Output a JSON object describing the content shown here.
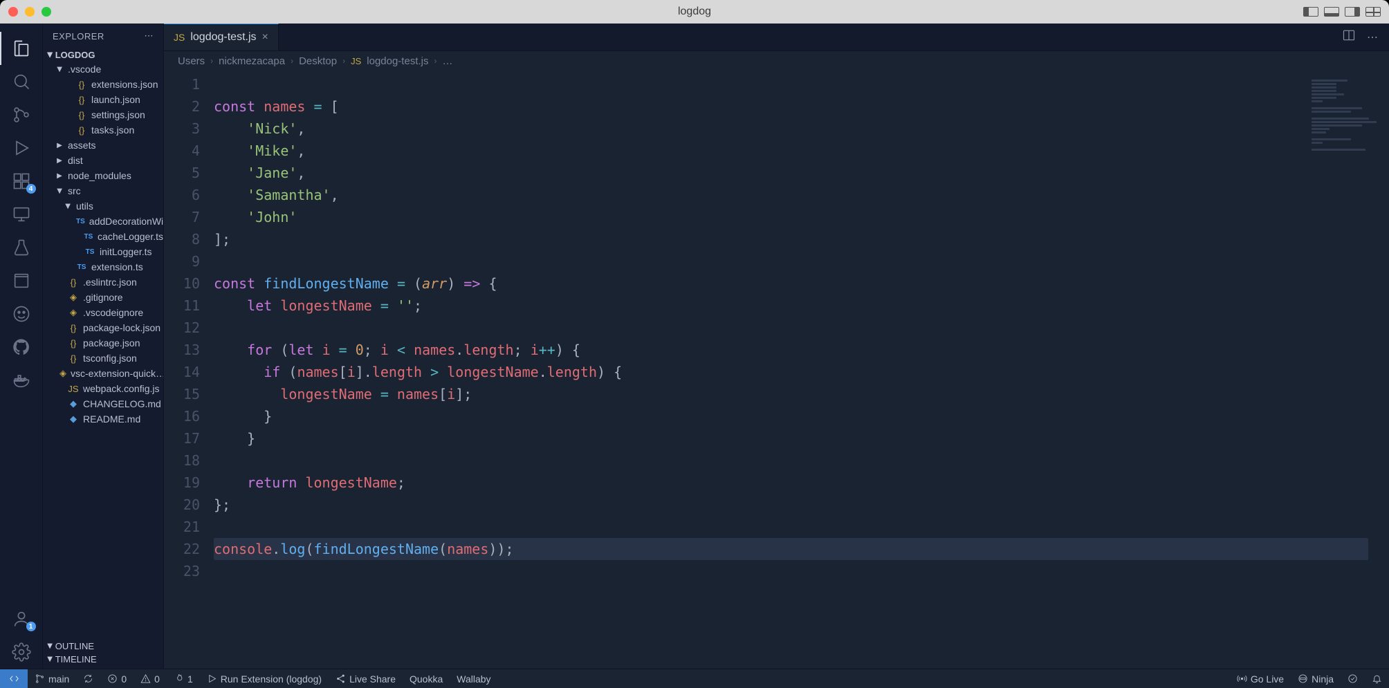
{
  "window": {
    "title": "logdog"
  },
  "titlebar_icons": [
    "split-l",
    "split-b",
    "split-r",
    "grid"
  ],
  "activitybar": {
    "top": [
      {
        "name": "explorer",
        "active": true
      },
      {
        "name": "search"
      },
      {
        "name": "scm"
      },
      {
        "name": "run-debug"
      },
      {
        "name": "extensions",
        "badge": "4"
      },
      {
        "name": "remote-explorer"
      },
      {
        "name": "testing"
      },
      {
        "name": "references"
      },
      {
        "name": "copilot"
      },
      {
        "name": "github"
      },
      {
        "name": "docker"
      }
    ],
    "bottom": [
      {
        "name": "accounts",
        "badge": "1"
      },
      {
        "name": "settings-gear"
      }
    ]
  },
  "sidebar": {
    "title": "EXPLORER",
    "folder": "LOGDOG",
    "tree": [
      {
        "type": "folder",
        "name": ".vscode",
        "expanded": true,
        "depth": 1,
        "children": [
          {
            "type": "file",
            "name": "extensions.json",
            "icon": "json",
            "depth": 2
          },
          {
            "type": "file",
            "name": "launch.json",
            "icon": "json",
            "depth": 2
          },
          {
            "type": "file",
            "name": "settings.json",
            "icon": "json",
            "depth": 2
          },
          {
            "type": "file",
            "name": "tasks.json",
            "icon": "json",
            "depth": 2
          }
        ]
      },
      {
        "type": "folder",
        "name": "assets",
        "expanded": false,
        "depth": 1
      },
      {
        "type": "folder",
        "name": "dist",
        "expanded": false,
        "depth": 1
      },
      {
        "type": "folder",
        "name": "node_modules",
        "expanded": false,
        "depth": 1
      },
      {
        "type": "folder",
        "name": "src",
        "expanded": true,
        "depth": 1,
        "children": [
          {
            "type": "folder",
            "name": "utils",
            "expanded": true,
            "depth": 2,
            "children": [
              {
                "type": "file",
                "name": "addDecorationWi…",
                "icon": "ts",
                "depth": 3
              },
              {
                "type": "file",
                "name": "cacheLogger.ts",
                "icon": "ts",
                "depth": 3
              },
              {
                "type": "file",
                "name": "initLogger.ts",
                "icon": "ts",
                "depth": 3
              }
            ]
          },
          {
            "type": "file",
            "name": "extension.ts",
            "icon": "ts",
            "depth": 2
          }
        ]
      },
      {
        "type": "file",
        "name": ".eslintrc.json",
        "icon": "json",
        "depth": 1
      },
      {
        "type": "file",
        "name": ".gitignore",
        "icon": "file",
        "depth": 1
      },
      {
        "type": "file",
        "name": ".vscodeignore",
        "icon": "file",
        "depth": 1
      },
      {
        "type": "file",
        "name": "package-lock.json",
        "icon": "json",
        "depth": 1
      },
      {
        "type": "file",
        "name": "package.json",
        "icon": "json",
        "depth": 1
      },
      {
        "type": "file",
        "name": "tsconfig.json",
        "icon": "json",
        "depth": 1
      },
      {
        "type": "file",
        "name": "vsc-extension-quick…",
        "icon": "file",
        "depth": 1
      },
      {
        "type": "file",
        "name": "webpack.config.js",
        "icon": "js",
        "depth": 1
      },
      {
        "type": "file",
        "name": "CHANGELOG.md",
        "icon": "md",
        "depth": 1
      },
      {
        "type": "file",
        "name": "README.md",
        "icon": "md",
        "depth": 1
      }
    ],
    "outline": "OUTLINE",
    "timeline": "TIMELINE"
  },
  "tabs": [
    {
      "label": "logdog-test.js",
      "icon": "JS",
      "active": true
    }
  ],
  "breadcrumbs": [
    "Users",
    "nickmezacapa",
    "Desktop",
    "logdog-test.js",
    "…"
  ],
  "code": {
    "lines": [
      {
        "n": 1,
        "tokens": []
      },
      {
        "n": 2,
        "tokens": [
          [
            "kw",
            "const"
          ],
          [
            "pn",
            " "
          ],
          [
            "vr",
            "names"
          ],
          [
            "pn",
            " "
          ],
          [
            "op",
            "="
          ],
          [
            "pn",
            " "
          ],
          [
            "pn",
            "["
          ]
        ]
      },
      {
        "n": 3,
        "tokens": [
          [
            "pn",
            "    "
          ],
          [
            "str",
            "'Nick'"
          ],
          [
            "pn",
            ","
          ]
        ]
      },
      {
        "n": 4,
        "tokens": [
          [
            "pn",
            "    "
          ],
          [
            "str",
            "'Mike'"
          ],
          [
            "pn",
            ","
          ]
        ]
      },
      {
        "n": 5,
        "tokens": [
          [
            "pn",
            "    "
          ],
          [
            "str",
            "'Jane'"
          ],
          [
            "pn",
            ","
          ]
        ]
      },
      {
        "n": 6,
        "tokens": [
          [
            "pn",
            "    "
          ],
          [
            "str",
            "'Samantha'"
          ],
          [
            "pn",
            ","
          ]
        ]
      },
      {
        "n": 7,
        "tokens": [
          [
            "pn",
            "    "
          ],
          [
            "str",
            "'John'"
          ]
        ]
      },
      {
        "n": 8,
        "tokens": [
          [
            "pn",
            "]"
          ],
          [
            "pn",
            ";"
          ]
        ]
      },
      {
        "n": 9,
        "tokens": []
      },
      {
        "n": 10,
        "tokens": [
          [
            "kw",
            "const"
          ],
          [
            "pn",
            " "
          ],
          [
            "fn",
            "findLongestName"
          ],
          [
            "pn",
            " "
          ],
          [
            "op",
            "="
          ],
          [
            "pn",
            " "
          ],
          [
            "pn",
            "("
          ],
          [
            "pa",
            "arr"
          ],
          [
            "pn",
            ")"
          ],
          [
            "pn",
            " "
          ],
          [
            "kw",
            "=>"
          ],
          [
            "pn",
            " "
          ],
          [
            "pn",
            "{"
          ]
        ]
      },
      {
        "n": 11,
        "tokens": [
          [
            "pn",
            "    "
          ],
          [
            "kw",
            "let"
          ],
          [
            "pn",
            " "
          ],
          [
            "vr",
            "longestName"
          ],
          [
            "pn",
            " "
          ],
          [
            "op",
            "="
          ],
          [
            "pn",
            " "
          ],
          [
            "str",
            "''"
          ],
          [
            "pn",
            ";"
          ]
        ]
      },
      {
        "n": 12,
        "tokens": []
      },
      {
        "n": 13,
        "tokens": [
          [
            "pn",
            "    "
          ],
          [
            "kw",
            "for"
          ],
          [
            "pn",
            " "
          ],
          [
            "pn",
            "("
          ],
          [
            "kw",
            "let"
          ],
          [
            "pn",
            " "
          ],
          [
            "vr",
            "i"
          ],
          [
            "pn",
            " "
          ],
          [
            "op",
            "="
          ],
          [
            "pn",
            " "
          ],
          [
            "nm",
            "0"
          ],
          [
            "pn",
            "; "
          ],
          [
            "vr",
            "i"
          ],
          [
            "pn",
            " "
          ],
          [
            "op",
            "<"
          ],
          [
            "pn",
            " "
          ],
          [
            "vr",
            "names"
          ],
          [
            "pn",
            "."
          ],
          [
            "vr",
            "length"
          ],
          [
            "pn",
            "; "
          ],
          [
            "vr",
            "i"
          ],
          [
            "op",
            "++"
          ],
          [
            "pn",
            ")"
          ],
          [
            "pn",
            " "
          ],
          [
            "pn",
            "{"
          ]
        ]
      },
      {
        "n": 14,
        "tokens": [
          [
            "pn",
            "      "
          ],
          [
            "kw",
            "if"
          ],
          [
            "pn",
            " "
          ],
          [
            "pn",
            "("
          ],
          [
            "vr",
            "names"
          ],
          [
            "pn",
            "["
          ],
          [
            "vr",
            "i"
          ],
          [
            "pn",
            "]."
          ],
          [
            "vr",
            "length"
          ],
          [
            "pn",
            " "
          ],
          [
            "op",
            ">"
          ],
          [
            "pn",
            " "
          ],
          [
            "vr",
            "longestName"
          ],
          [
            "pn",
            "."
          ],
          [
            "vr",
            "length"
          ],
          [
            "pn",
            ")"
          ],
          [
            "pn",
            " "
          ],
          [
            "pn",
            "{"
          ]
        ]
      },
      {
        "n": 15,
        "tokens": [
          [
            "pn",
            "        "
          ],
          [
            "vr",
            "longestName"
          ],
          [
            "pn",
            " "
          ],
          [
            "op",
            "="
          ],
          [
            "pn",
            " "
          ],
          [
            "vr",
            "names"
          ],
          [
            "pn",
            "["
          ],
          [
            "vr",
            "i"
          ],
          [
            "pn",
            "];"
          ]
        ]
      },
      {
        "n": 16,
        "tokens": [
          [
            "pn",
            "      "
          ],
          [
            "pn",
            "}"
          ]
        ]
      },
      {
        "n": 17,
        "tokens": [
          [
            "pn",
            "    "
          ],
          [
            "pn",
            "}"
          ]
        ]
      },
      {
        "n": 18,
        "tokens": []
      },
      {
        "n": 19,
        "tokens": [
          [
            "pn",
            "    "
          ],
          [
            "kw",
            "return"
          ],
          [
            "pn",
            " "
          ],
          [
            "vr",
            "longestName"
          ],
          [
            "pn",
            ";"
          ]
        ]
      },
      {
        "n": 20,
        "tokens": [
          [
            "pn",
            "};"
          ]
        ]
      },
      {
        "n": 21,
        "tokens": []
      },
      {
        "n": 22,
        "hl": true,
        "tokens": [
          [
            "vr",
            "console"
          ],
          [
            "pn",
            "."
          ],
          [
            "fn",
            "log"
          ],
          [
            "pn",
            "("
          ],
          [
            "fn",
            "findLongestName"
          ],
          [
            "pn",
            "("
          ],
          [
            "vr",
            "names"
          ],
          [
            "pn",
            "));"
          ]
        ]
      },
      {
        "n": 23,
        "tokens": []
      }
    ]
  },
  "statusbar": {
    "left": [
      {
        "icon": "branch",
        "label": "main"
      },
      {
        "icon": "sync",
        "label": ""
      },
      {
        "icon": "error",
        "label": "0"
      },
      {
        "icon": "warning",
        "label": "0"
      },
      {
        "icon": "flame",
        "label": "1"
      },
      {
        "icon": "play",
        "label": "Run Extension (logdog)"
      },
      {
        "icon": "share",
        "label": "Live Share"
      },
      {
        "label": "Quokka"
      },
      {
        "label": "Wallaby"
      }
    ],
    "right": [
      {
        "icon": "broadcast",
        "label": "Go Live"
      },
      {
        "icon": "ninja",
        "label": "Ninja"
      },
      {
        "icon": "check",
        "label": ""
      },
      {
        "icon": "bell",
        "label": ""
      }
    ]
  }
}
